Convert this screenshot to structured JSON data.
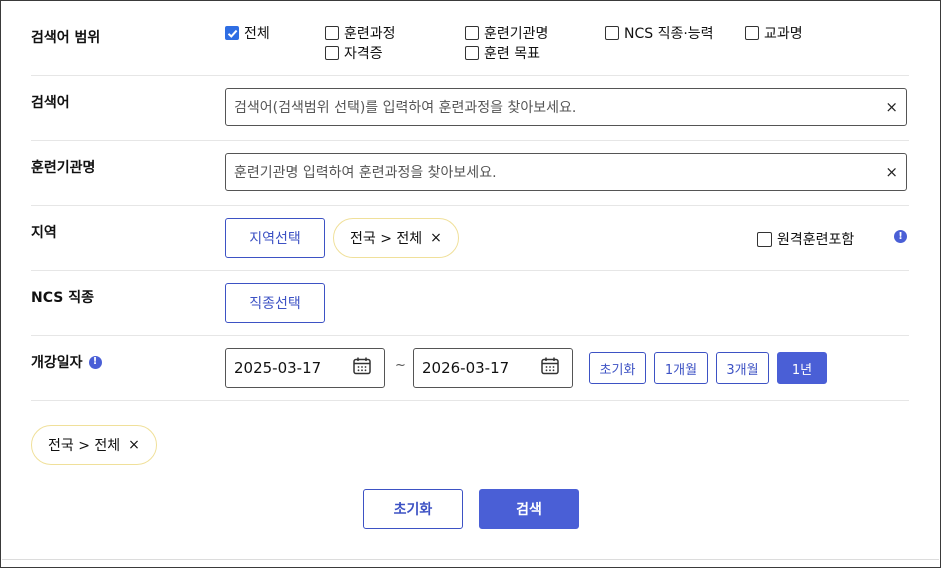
{
  "scope": {
    "label": "검색어 범위",
    "options": [
      {
        "label": "전체",
        "checked": true
      },
      {
        "label": "훈련과정",
        "checked": false
      },
      {
        "label": "훈련기관명",
        "checked": false
      },
      {
        "label": "NCS 직종·능력",
        "checked": false
      },
      {
        "label": "교과명",
        "checked": false
      },
      {
        "label": "자격증",
        "checked": false
      },
      {
        "label": "훈련 목표",
        "checked": false
      }
    ]
  },
  "keyword": {
    "label": "검색어",
    "placeholder": "검색어(검색범위 선택)를 입력하여 훈련과정을 찾아보세요.",
    "clear": "×"
  },
  "institution": {
    "label": "훈련기관명",
    "placeholder": "훈련기관명 입력하여 훈련과정을 찾아보세요.",
    "clear": "×"
  },
  "region": {
    "label": "지역",
    "select_button": "지역선택",
    "chip": "전국 > 전체",
    "chip_remove": "×",
    "remote_label": "원격훈련포함",
    "remote_checked": false,
    "info": "!"
  },
  "ncs": {
    "label": "NCS 직종",
    "select_button": "직종선택"
  },
  "date": {
    "label": "개강일자",
    "info": "!",
    "start": "2025-03-17",
    "end": "2026-03-17",
    "separator": "~",
    "presets": [
      {
        "label": "초기화",
        "active": false
      },
      {
        "label": "1개월",
        "active": false
      },
      {
        "label": "3개월",
        "active": false
      },
      {
        "label": "1년",
        "active": true
      }
    ]
  },
  "selected_chip": {
    "label": "전국 > 전체",
    "remove": "×"
  },
  "actions": {
    "reset": "초기화",
    "search": "검색"
  },
  "colors": {
    "primary": "#4a5fd6",
    "checkbox": "#2f6ee3",
    "chip_border": "#f0e09a"
  },
  "icons": [
    "check-icon",
    "clear-icon",
    "info-icon",
    "calendar-icon",
    "close-icon"
  ]
}
